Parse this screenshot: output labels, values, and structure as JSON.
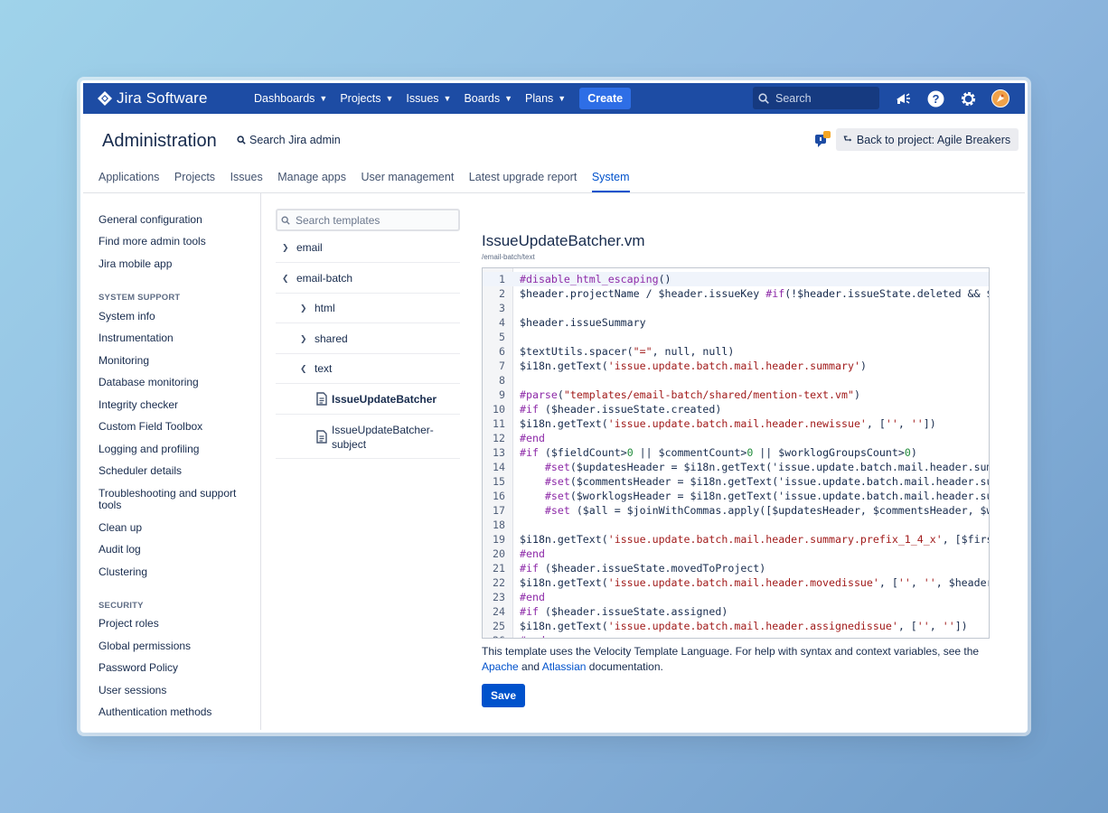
{
  "app": {
    "name": "Jira Software",
    "brand_color": "#1d4ca4",
    "accent_color": "#0052cc"
  },
  "topnav": {
    "items": [
      {
        "label": "Dashboards",
        "icon": "chevron-down-icon"
      },
      {
        "label": "Projects",
        "icon": "chevron-down-icon"
      },
      {
        "label": "Issues",
        "icon": "chevron-down-icon"
      },
      {
        "label": "Boards",
        "icon": "chevron-down-icon"
      },
      {
        "label": "Plans",
        "icon": "chevron-down-icon"
      }
    ],
    "create_label": "Create",
    "search_placeholder": "Search",
    "icons": [
      "megaphone-icon",
      "help-icon",
      "settings-icon",
      "avatar"
    ]
  },
  "admin": {
    "title": "Administration",
    "search_label": "Search Jira admin",
    "back_label": "Back to project: Agile Breakers",
    "tabs": [
      "Applications",
      "Projects",
      "Issues",
      "Manage apps",
      "User management",
      "Latest upgrade report",
      "System"
    ],
    "active_tab": "System"
  },
  "sidebar": {
    "top_links": [
      "General configuration",
      "Find more admin tools",
      "Jira mobile app"
    ],
    "system_support_heading": "SYSTEM SUPPORT",
    "system_support_links": [
      "System info",
      "Instrumentation",
      "Monitoring",
      "Database monitoring",
      "Integrity checker",
      "Custom Field Toolbox",
      "Logging and profiling",
      "Scheduler details",
      "Troubleshooting and support tools",
      "Clean up",
      "Audit log",
      "Clustering"
    ],
    "security_heading": "SECURITY",
    "security_links": [
      "Project roles",
      "Global permissions",
      "Password Policy",
      "User sessions",
      "Authentication methods"
    ]
  },
  "tree": {
    "search_placeholder": "Search templates",
    "nodes": {
      "email": "email",
      "email_batch": "email-batch",
      "html": "html",
      "shared": "shared",
      "text": "text",
      "file1": "IssueUpdateBatcher",
      "file2": "IssueUpdateBatcher-subject"
    }
  },
  "editor": {
    "file_name": "IssueUpdateBatcher.vm",
    "file_path": "/email-batch/text",
    "lines": [
      "#disable_html_escaping()",
      "$header.projectName / $header.issueKey #if(!$header.issueState.deleted && $",
      "",
      "$header.issueSummary",
      "",
      "$textUtils.spacer(\"=\", null, null)",
      "$i18n.getText('issue.update.batch.mail.header.summary')",
      "",
      "#parse(\"templates/email-batch/shared/mention-text.vm\")",
      "#if ($header.issueState.created)",
      "$i18n.getText('issue.update.batch.mail.header.newissue', ['', ''])",
      "#end",
      "#if ($fieldCount>0 || $commentCount>0 || $worklogGroupsCount>0)",
      "    #set($updatesHeader = $i18n.getText('issue.update.batch.mail.header.summ",
      "    #set($commentsHeader = $i18n.getText('issue.update.batch.mail.header.su",
      "    #set($worklogsHeader = $i18n.getText('issue.update.batch.mail.header.su",
      "    #set ($all = $joinWithCommas.apply([$updatesHeader, $commentsHeader, $w",
      "",
      "$i18n.getText('issue.update.batch.mail.header.summary.prefix_1_4_x', [$firs",
      "#end",
      "#if ($header.issueState.movedToProject)",
      "$i18n.getText('issue.update.batch.mail.header.movedissue', ['', '', $header",
      "#end",
      "#if ($header.issueState.assigned)",
      "$i18n.getText('issue.update.batch.mail.header.assignedissue', ['', ''])",
      "#end"
    ]
  },
  "help": {
    "text_before": "This template uses the Velocity Template Language. For help with syntax and context variables, see the",
    "link1": "Apache",
    "and": "and",
    "link2": "Atlassian",
    "text_after": "documentation."
  },
  "save_label": "Save"
}
